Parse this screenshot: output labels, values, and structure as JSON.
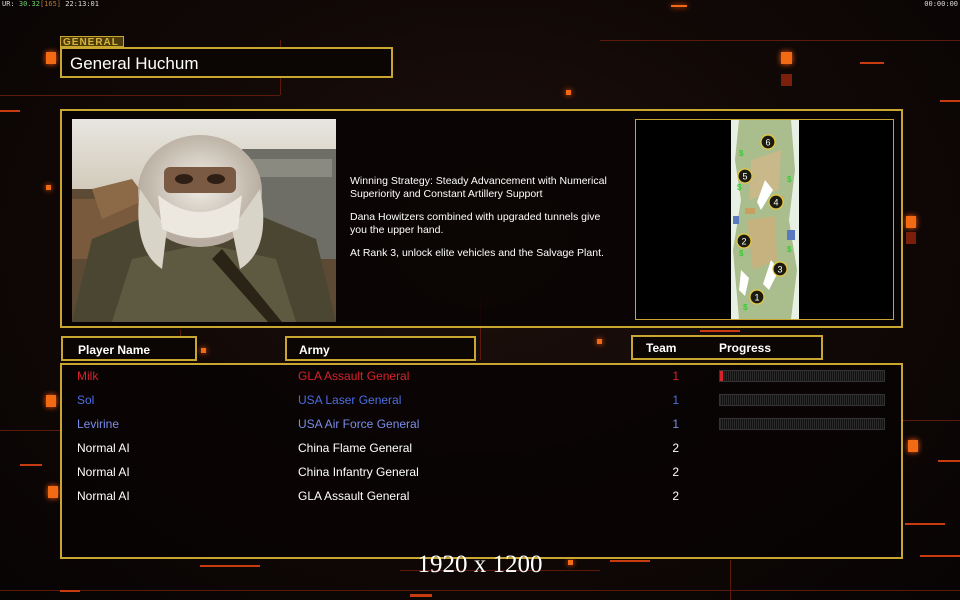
{
  "status_bar": {
    "left_prefix": "UR:",
    "left_green": "30.32",
    "left_bracket": "[165]",
    "left_time": "22:13:01",
    "right_time": "00:00:00"
  },
  "general_panel": {
    "tag_label": "GENERAL",
    "name": "General Huchum"
  },
  "briefing": {
    "strategy": "Winning Strategy: Steady Advancement with Numerical\n Superiority and Constant Artillery Support",
    "tip_1": "Dana Howitzers combined with upgraded tunnels give\n you the upper hand.",
    "tip_2": "At Rank 3, unlock elite vehicles and the Salvage Plant."
  },
  "map": {
    "start_positions": [
      "1",
      "2",
      "3",
      "4",
      "5",
      "6"
    ]
  },
  "table_headers": {
    "player_name": "Player Name",
    "army": "Army",
    "team": "Team",
    "progress": "Progress"
  },
  "players": [
    {
      "name": "Milk",
      "army": "GLA Assault General",
      "team": "1",
      "color": "#d8232a",
      "progress": 0.02,
      "show_progress": true
    },
    {
      "name": "Sol",
      "army": "USA Laser General",
      "team": "1",
      "color": "#4a6ee0",
      "progress": 0,
      "show_progress": true
    },
    {
      "name": "Levirine",
      "army": "USA Air Force General",
      "team": "1",
      "color": "#7a8ee8",
      "progress": 0,
      "show_progress": true
    },
    {
      "name": "Normal AI",
      "army": "China Flame General",
      "team": "2",
      "color": "#ffffff",
      "progress": 0,
      "show_progress": false
    },
    {
      "name": "Normal AI",
      "army": "China Infantry General",
      "team": "2",
      "color": "#ffffff",
      "progress": 0,
      "show_progress": false
    },
    {
      "name": "Normal AI",
      "army": "GLA Assault General",
      "team": "2",
      "color": "#ffffff",
      "progress": 0,
      "show_progress": false
    }
  ],
  "resolution_caption": "1920 x 1200",
  "colors": {
    "accent_gold": "#c8a630",
    "background": "#0b0706",
    "glow_orange": "#f26a14"
  }
}
